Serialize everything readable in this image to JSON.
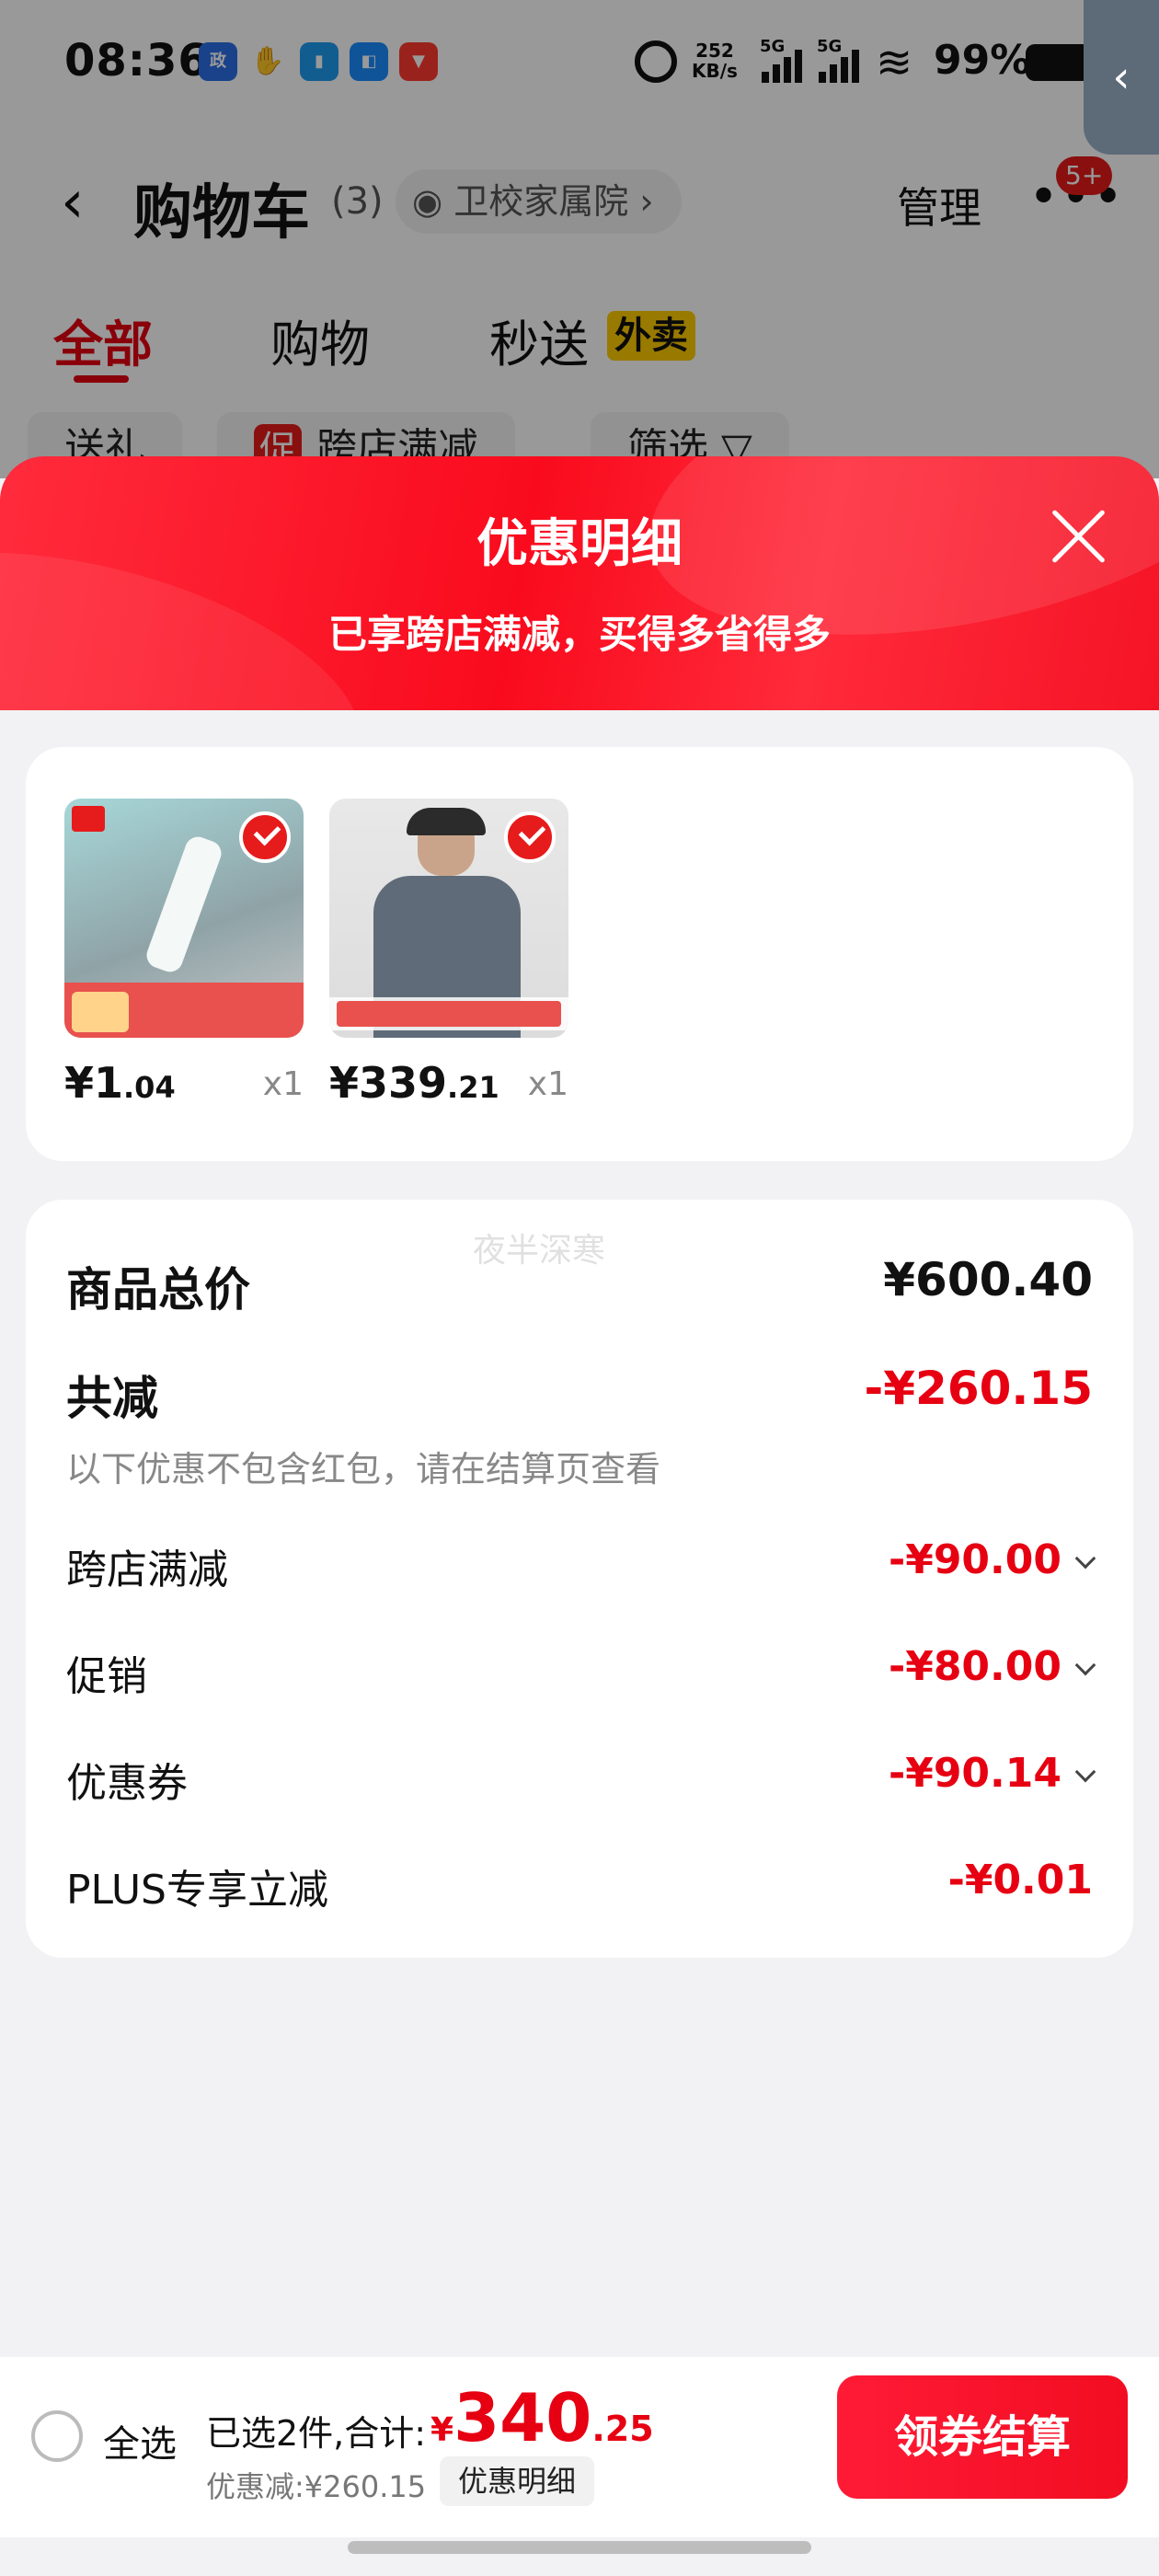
{
  "status_bar": {
    "time": "08:36",
    "app_icons": [
      "政务",
      "握手",
      "手机",
      "相册",
      "喜马拉雅"
    ],
    "net_speed_value": "252",
    "net_speed_unit": "KB/s",
    "signal_1": "5G",
    "signal_2": "5G",
    "battery": "99%"
  },
  "cart_header": {
    "back_icon": "chevron-left-icon",
    "title": "购物车",
    "count": "(3)",
    "location": "卫校家属院",
    "manage": "管理",
    "more_icon": "more-dots-icon",
    "message_badge": "5+"
  },
  "tabs": [
    {
      "label": "全部",
      "active": true
    },
    {
      "label": "购物",
      "active": false
    },
    {
      "label": "秒送",
      "active": false,
      "tag": "外卖"
    }
  ],
  "filters": [
    {
      "label": "送礼"
    },
    {
      "label": "跨店满减",
      "mark": "促"
    },
    {
      "label": "筛选 ▽"
    }
  ],
  "sheet": {
    "title": "优惠明细",
    "subtitle": "已享跨店满减，买得多省得多",
    "close_icon": "close-icon"
  },
  "products": [
    {
      "price_int": "¥1",
      "price_dec": ".04",
      "qty": "x1",
      "image": "glue-stick-image",
      "selected": true
    },
    {
      "price_int": "¥339",
      "price_dec": ".21",
      "qty": "x1",
      "image": "jacket-image",
      "selected": true
    }
  ],
  "summary": {
    "watermark": "夜半深寒",
    "goods_total_label": "商品总价",
    "goods_total_value": "¥600.40",
    "total_reduction_label": "共减",
    "total_reduction_value": "-¥260.15",
    "note": "以下优惠不包含红包，请在结算页查看",
    "items": [
      {
        "label": "跨店满减",
        "value": "-¥90.00",
        "expandable": true
      },
      {
        "label": "促销",
        "value": "-¥80.00",
        "expandable": true
      },
      {
        "label": "优惠券",
        "value": "-¥90.14",
        "expandable": true
      },
      {
        "label": "PLUS专享立减",
        "value": "-¥0.01",
        "expandable": false
      }
    ]
  },
  "bottom_bar": {
    "select_all": "全选",
    "selected_text": "已选2件,合计:",
    "currency": "¥",
    "total_int": "340",
    "total_dec": ".25",
    "saved_text": "优惠减:¥260.15",
    "detail_button": "优惠明细",
    "checkout_button": "领券结算"
  },
  "colors": {
    "accent_red": "#e60012",
    "sheet_header_red": "#f90b1d",
    "coupon_tag_yellow": "#ffcc00"
  }
}
